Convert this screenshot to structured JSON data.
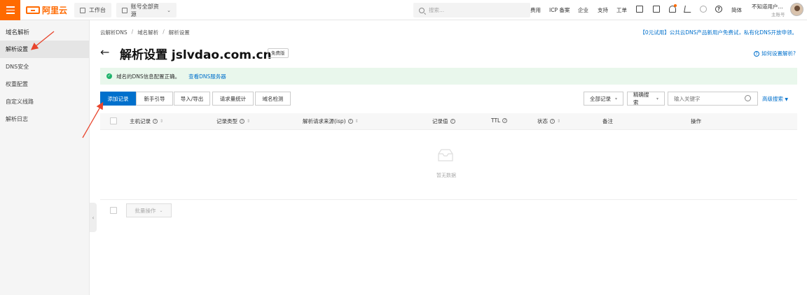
{
  "topbar": {
    "logo_text": "阿里云",
    "workbench_label": "工作台",
    "resource_label": "账号全部资源",
    "search_placeholder": "搜索...",
    "nav": [
      "费用",
      "ICP 备案",
      "企业",
      "支持",
      "工单"
    ],
    "language": "简体",
    "user_name": "不知道用户...",
    "user_role": "主账号"
  },
  "sidebar": {
    "title": "域名解析",
    "items": [
      {
        "label": "解析设置",
        "active": true
      },
      {
        "label": "DNS安全",
        "active": false
      },
      {
        "label": "权重配置",
        "active": false
      },
      {
        "label": "自定义线路",
        "active": false
      },
      {
        "label": "解析日志",
        "active": false
      }
    ]
  },
  "breadcrumb": [
    "云解析DNS",
    "域名解析",
    "解析设置"
  ],
  "promo_text": "【0元试用】公共云DNS产品新用户免费试，私有化DNS开放申领。",
  "page": {
    "title": "解析设置 jslvdao.com.cn",
    "badge": "免费版",
    "help_link": "如何设置解析?"
  },
  "alert": {
    "message": "域名的DNS信息配置正确。",
    "link": "查看DNS服务器"
  },
  "toolbar": {
    "buttons": [
      "添加记录",
      "新手引导",
      "导入/导出",
      "请求量统计",
      "域名检测"
    ],
    "filter_all": "全部记录",
    "filter_mode": "精确搜索",
    "keyword_placeholder": "输入关键字",
    "advanced": "高级搜索"
  },
  "table": {
    "headers": [
      "主机记录",
      "记录类型",
      "解析请求来源(isp)",
      "记录值",
      "TTL",
      "状态",
      "备注",
      "操作"
    ],
    "empty_text": "暂无数据",
    "batch_label": "批量操作"
  },
  "colors": {
    "brand": "#ff6a00",
    "primary": "#0070cc",
    "success_bg": "#e9f7ec",
    "annotation": "#e8442c"
  }
}
